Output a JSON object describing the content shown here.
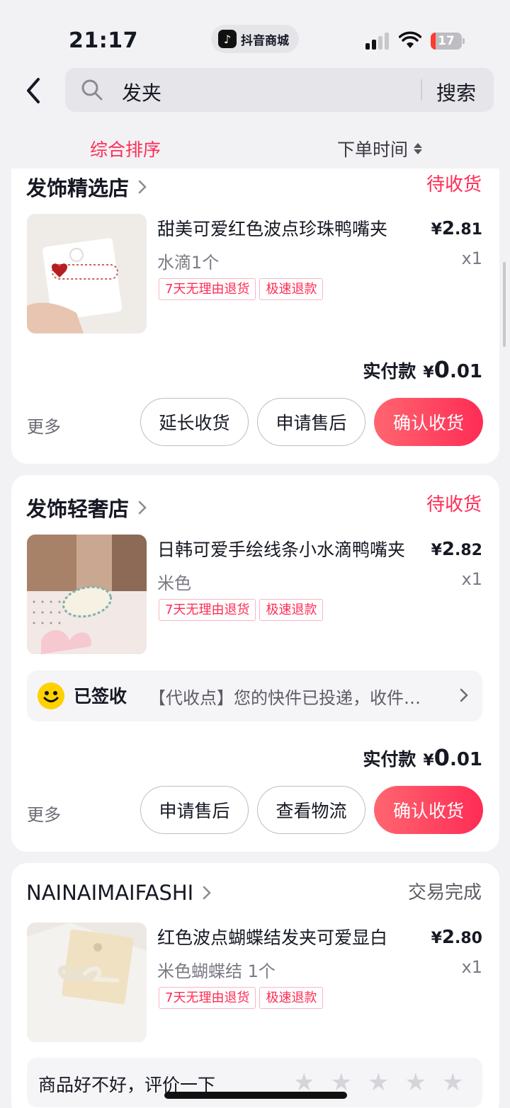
{
  "status_bar": {
    "time": "21:17",
    "app_pill": "抖音商城",
    "battery": "17"
  },
  "search": {
    "query": "发夹",
    "button": "搜索"
  },
  "sort": {
    "primary": "综合排序",
    "secondary": "下单时间"
  },
  "orders": [
    {
      "shop": "发饰精选店",
      "status": "待收货",
      "product_title": "甜美可爱红色波点珍珠鸭嘴夹",
      "price_symbol": "¥",
      "price_int": "2",
      "price_dec": ".81",
      "sku": "水滴1个",
      "qty": "x1",
      "tags": [
        "7天无理由退货",
        "极速退款"
      ],
      "paid_label": "实付款",
      "paid_symbol": "¥",
      "paid_int": "0",
      "paid_dec": ".01",
      "more": "更多",
      "buttons": [
        "延长收货",
        "申请售后",
        "确认收货"
      ]
    },
    {
      "shop": "发饰轻奢店",
      "status": "待收货",
      "product_title": "日韩可爱手绘线条小水滴鸭嘴夹",
      "price_symbol": "¥",
      "price_int": "2",
      "price_dec": ".82",
      "sku": "米色",
      "qty": "x1",
      "tags": [
        "7天无理由退货",
        "极速退款"
      ],
      "logistics_status": "已签收",
      "logistics_text": "【代收点】您的快件已投递，收件人可前往代收点取件",
      "paid_label": "实付款",
      "paid_symbol": "¥",
      "paid_int": "0",
      "paid_dec": ".01",
      "more": "更多",
      "buttons": [
        "申请售后",
        "查看物流",
        "确认收货"
      ]
    },
    {
      "shop": "NAINAIMAIFASHI",
      "status": "交易完成",
      "product_title": "红色波点蝴蝶结发夹可爱显白",
      "price_symbol": "¥",
      "price_int": "2",
      "price_dec": ".80",
      "sku": "米色蝴蝶结 1个",
      "qty": "x1",
      "tags": [
        "7天无理由退货",
        "极速退款"
      ],
      "review_prompt": "商品好不好，评价一下",
      "rating": 0
    }
  ],
  "colors": {
    "accent": "#fe2c55",
    "background": "#f2f2f5"
  }
}
